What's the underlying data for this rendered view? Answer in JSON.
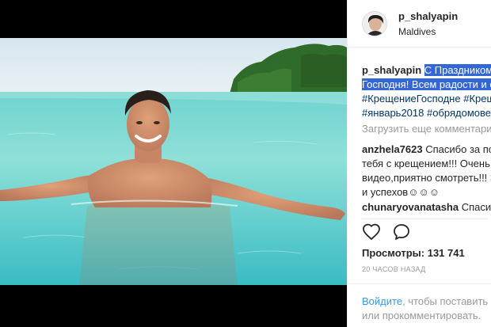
{
  "post": {
    "username": "p_shalyapin",
    "location": "Maldives",
    "caption": {
      "author": "p_shalyapin",
      "selected_line1": "С Праздником",
      "selected_line2": "Господня! Всем радости и с",
      "hashtag_line3a": "#КрещениеГосподне",
      "hashtag_line3b": "#Крещ",
      "hashtag_line4a": "#январь2018",
      "hashtag_line4b": "#обрядомове"
    },
    "load_more": "Загрузить еще комментари",
    "comments": [
      {
        "author": "anzhela7623",
        "line1": "Спасибо за по",
        "line2": "тебя с крещением!!! Очень",
        "line3": "видео,приятно смотреть!!! З",
        "line4": "и успехов☺☺☺"
      },
      {
        "author": "chunaryovanatasha",
        "line1": "Спасибо"
      }
    ],
    "actions": {
      "like_icon": "heart-icon",
      "comment_icon": "comment-bubble-icon"
    },
    "views_label": "Просмотры:",
    "views_count": "131 741",
    "time_ago": "20 ЧАСОВ НАЗАД",
    "login_prompt": {
      "link": "Войдите",
      "rest_line1": ", чтобы поставить «",
      "line2": "или прокомментировать."
    }
  },
  "colors": {
    "link_blue": "#3897f0",
    "hashtag_blue": "#003569",
    "selection_blue": "#3367d6",
    "muted_gray": "#999999",
    "text_dark": "#262626"
  }
}
